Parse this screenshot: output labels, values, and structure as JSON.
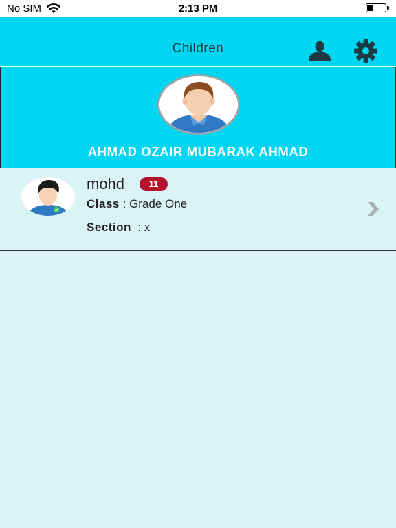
{
  "status_bar": {
    "carrier": "No SIM",
    "time": "2:13 PM",
    "battery_level": 0.35
  },
  "nav": {
    "title": "Children",
    "icons": [
      "user-icon",
      "gear-icon"
    ]
  },
  "profile": {
    "name": "AHMAD OZAIR MUBARAK AHMAD"
  },
  "children": [
    {
      "name": "mohd",
      "badge": "11",
      "class_label": "Class",
      "class_separator": ":",
      "class_value": "Grade One",
      "section_label": "Section",
      "section_separator": ":",
      "section_value": "x"
    }
  ],
  "colors": {
    "accent": "#00d5f2",
    "background": "#daf3f4",
    "badge": "#b5132d"
  }
}
